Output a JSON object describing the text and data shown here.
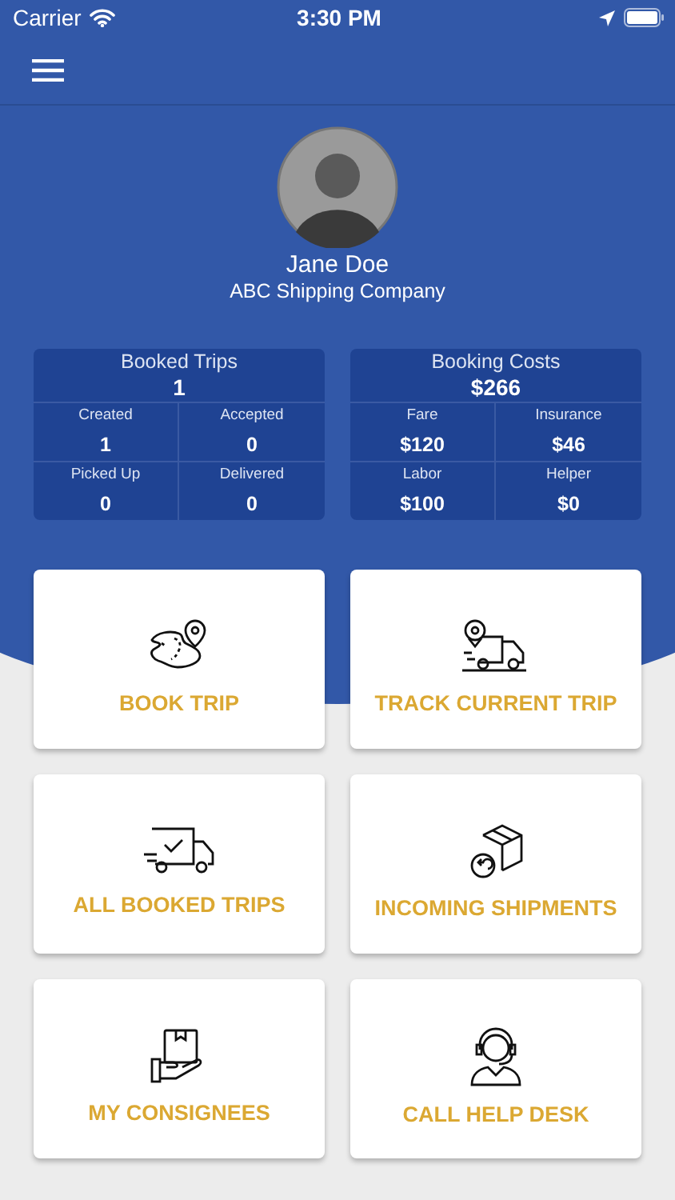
{
  "status_bar": {
    "carrier": "Carrier",
    "time": "3:30 PM"
  },
  "profile": {
    "name": "Jane Doe",
    "company": "ABC Shipping Company"
  },
  "stats": [
    {
      "title": "Booked Trips",
      "total": "1",
      "cells": [
        {
          "label": "Created",
          "value": "1"
        },
        {
          "label": "Accepted",
          "value": "0"
        },
        {
          "label": "Picked Up",
          "value": "0"
        },
        {
          "label": "Delivered",
          "value": "0"
        }
      ]
    },
    {
      "title": "Booking Costs",
      "total": "$266",
      "cells": [
        {
          "label": "Fare",
          "value": "$120"
        },
        {
          "label": "Insurance",
          "value": "$46"
        },
        {
          "label": "Labor",
          "value": "$100"
        },
        {
          "label": "Helper",
          "value": "$0"
        }
      ]
    }
  ],
  "tiles": [
    {
      "kind": "map",
      "label": "BOOK TRIP"
    },
    {
      "kind": "tracking",
      "label": "TRACK CURRENT TRIP"
    },
    {
      "kind": "truck",
      "label": "ALL BOOKED TRIPS"
    },
    {
      "kind": "box",
      "label": "INCOMING SHIPMENTS"
    },
    {
      "kind": "hand",
      "label": "MY CONSIGNEES"
    },
    {
      "kind": "agent",
      "label": "CALL HELP DESK"
    }
  ]
}
